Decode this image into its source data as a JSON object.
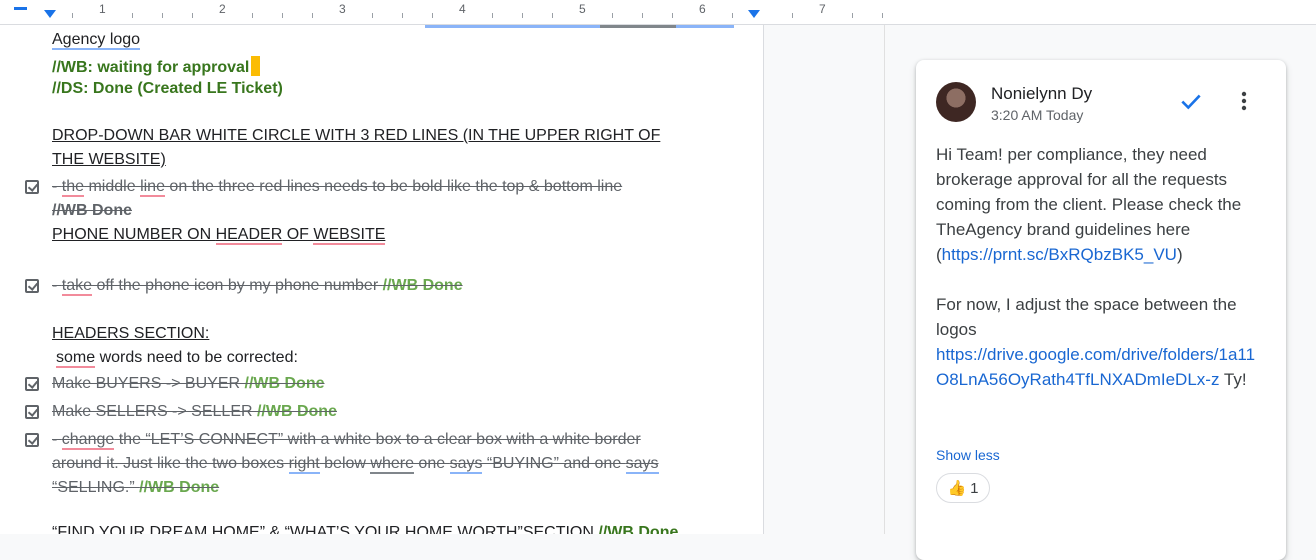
{
  "ruler": {
    "numbers": [
      "1",
      "2",
      "3",
      "4",
      "5",
      "6",
      "7"
    ]
  },
  "doc": {
    "agency_logo": "Agency logo",
    "wb_waiting": "//WB: waiting for approval",
    "ds_done": "//DS: Done (Created LE Ticket)",
    "dropdown_heading_1": "DROP-DOWN BAR WHITE CIRCLE WITH 3 RED LINES (IN THE UPPER RIGHT OF",
    "dropdown_heading_2": "THE WEBSITE)",
    "task1_a": "- ",
    "task1_b": "the",
    "task1_c": " middle ",
    "task1_d": "line",
    "task1_e": " on the three red lines needs to be bold like the top & bottom line",
    "task1_done": "//WB Done",
    "phone_a": "PHONE NUMBER ON ",
    "phone_b": "HEADER",
    "phone_c": " OF ",
    "phone_d": "WEBSITE",
    "task2_a": "- ",
    "task2_b": "take",
    "task2_c": " off the phone icon by my phone number ",
    "task2_done": "//WB Done",
    "headers_heading": " HEADERS SECTION:",
    "some_a": "some",
    "some_b": " words need to be corrected:",
    "task3": "Make BUYERS -> BUYER ",
    "task3_done": "//WB Done",
    "task4": "Make SELLERS -> SELLER ",
    "task4_done": "//WB Done",
    "task5_a": "- ",
    "task5_b": "change",
    "task5_c": " the “LET’S CONNECT” with a white box to a clear box with a white border",
    "task5_line2_a": "around it. Just like the two boxes ",
    "task5_line2_b": "right",
    "task5_line2_c": " below ",
    "task5_line2_d": "where",
    "task5_line2_e": " one ",
    "task5_line2_f": "says",
    "task5_line2_g": " “BUYING” and one ",
    "task5_line2_h": "says",
    "task5_line3": "“SELLING.” ",
    "task5_done": "//WB Done",
    "last_line": "“FIND YOUR DREAM HOME” & “WHAT’S YOUR HOME WORTH”SECTION ",
    "last_done": "//WB Done"
  },
  "comment": {
    "author": "Nonielynn Dy",
    "time": "3:20 AM Today",
    "text_1": "Hi Team! per compliance, they need brokerage approval for all the requests coming from the client. Please check the TheAgency brand guidelines here (",
    "link_1": "https://prnt.sc/BxRQbzBK5_VU",
    "text_2": ")",
    "text_3": "For now, I adjust the space between the logos",
    "link_2": "https://drive.google.com/drive/folders/1a11O8LnA56OyRath4TfLNXADmIeDLx-z",
    "text_4": " Ty!",
    "show_less": "Show less",
    "reaction_emoji": "👍",
    "reaction_count": "1"
  },
  "colors": {
    "accent": "#1a73e8",
    "done_green": "#38761d",
    "cursor": "#fbbc04"
  },
  "icons": [
    "resolve-check-icon",
    "more-vert-icon",
    "checkbox-checked-icon"
  ]
}
